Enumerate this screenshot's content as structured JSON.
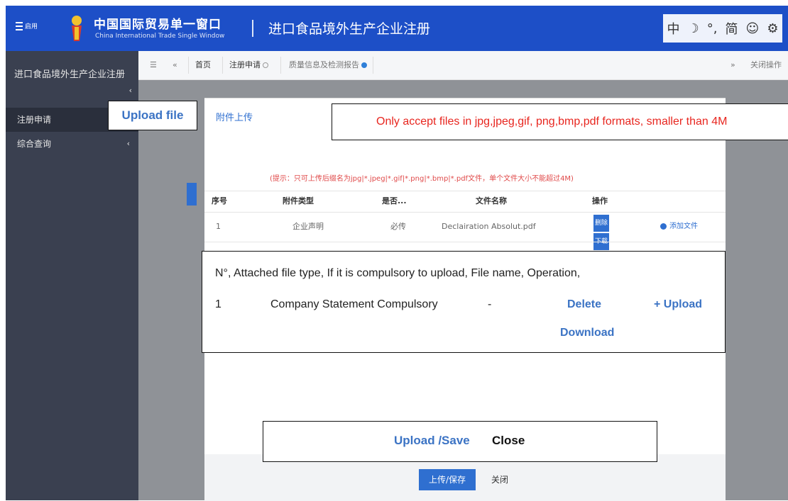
{
  "header": {
    "menu_label": "启用",
    "brand_cn": "中国国际贸易单一窗口",
    "brand_en": "China International Trade Single Window",
    "app_title": "进口食品境外生产企业注册",
    "tools": [
      "中",
      "☽",
      "°,",
      "简",
      "☺",
      "⚙"
    ]
  },
  "sidebar": {
    "title": "进口食品境外生产企业注册",
    "items": [
      {
        "label": "注册申请"
      },
      {
        "label": "综合查询"
      }
    ]
  },
  "tabbar": {
    "tabs": [
      {
        "label": "首页"
      },
      {
        "label": "注册申请"
      },
      {
        "label": "质量信息及检测报告"
      }
    ],
    "right_label": "关闭操作"
  },
  "modal": {
    "title": "附件上传",
    "hint": "(提示：只可上传后缀名为jpg|*.jpeg|*.gif|*.png|*.bmp|*.pdf文件，单个文件大小不能超过4M)",
    "columns": [
      "序号",
      "附件类型",
      "是否...",
      "文件名称",
      "操作"
    ],
    "rows": [
      {
        "no": "1",
        "type": "企业声明",
        "required": "必传",
        "filename": "Declairation Absolut.pdf",
        "delete": "删除",
        "download": "下载",
        "add": "添加文件"
      }
    ],
    "save_label": "上传/保存",
    "close_label": "关闭"
  },
  "annotations": {
    "upload_file": "Upload file",
    "accept_note": "Only accept files in jpg,jpeg,gif, png,bmp,pdf formats, smaller than 4M",
    "header_line": "N°, Attached file type, If it is compulsory to upload, File name, Operation,",
    "row_no": "1",
    "row_type": "Company Statement Compulsory",
    "row_dash": "-",
    "row_delete": "Delete",
    "row_upload": "+ Upload",
    "row_download": "Download",
    "footer_save": "Upload /Save",
    "footer_close": "Close"
  },
  "colors": {
    "header_bg": "#1d4fc7",
    "sidebar_bg": "#3a4050",
    "accent_blue": "#2f6fd0",
    "annotation_blue": "#3b73c4",
    "annotation_red": "#e8261f"
  }
}
